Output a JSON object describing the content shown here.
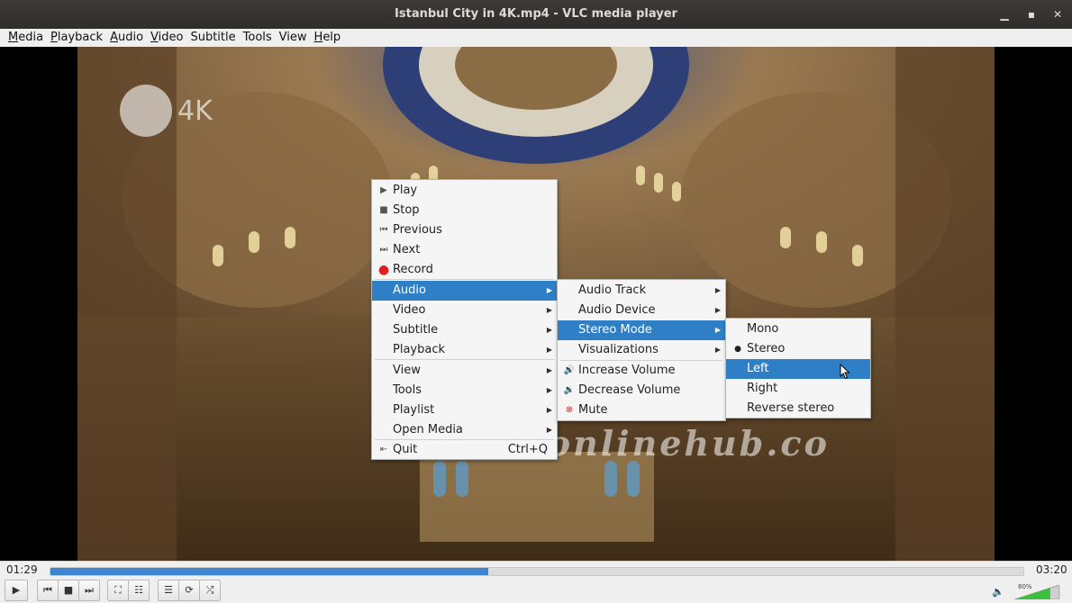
{
  "window": {
    "title": "Istanbul City in 4K.mp4 - VLC media player"
  },
  "menubar": {
    "items": [
      {
        "underline": "M",
        "rest": "edia"
      },
      {
        "underline": "P",
        "rest": "layback"
      },
      {
        "underline": "A",
        "rest": "udio"
      },
      {
        "underline": "V",
        "rest": "ideo"
      },
      {
        "underline": "",
        "rest": "Subtitle"
      },
      {
        "underline": "",
        "rest": "Tools"
      },
      {
        "underline": "",
        "rest": "View"
      },
      {
        "underline": "H",
        "rest": "elp"
      }
    ]
  },
  "video": {
    "logo_text": "4K",
    "watermark": "mulhamonlinehub.co"
  },
  "context_menu": {
    "items": [
      {
        "label": "Play",
        "icon": "play-icon"
      },
      {
        "label": "Stop",
        "icon": "stop-icon"
      },
      {
        "label": "Previous",
        "icon": "previous-icon"
      },
      {
        "label": "Next",
        "icon": "next-icon"
      },
      {
        "label": "Record",
        "icon": "record-icon"
      },
      {
        "label": "Audio",
        "submenu": true,
        "selected": true
      },
      {
        "label": "Video",
        "submenu": true
      },
      {
        "label": "Subtitle",
        "submenu": true
      },
      {
        "label": "Playback",
        "submenu": true
      },
      {
        "label": "View",
        "submenu": true
      },
      {
        "label": "Tools",
        "submenu": true
      },
      {
        "label": "Playlist",
        "submenu": true
      },
      {
        "label": "Open Media",
        "submenu": true
      },
      {
        "label": "Quit",
        "icon": "quit-icon",
        "shortcut": "Ctrl+Q"
      }
    ]
  },
  "audio_submenu": {
    "items": [
      {
        "label": "Audio Track",
        "submenu": true
      },
      {
        "label": "Audio Device",
        "submenu": true
      },
      {
        "label": "Stereo Mode",
        "submenu": true,
        "selected": true
      },
      {
        "label": "Visualizations",
        "submenu": true
      },
      {
        "label": "Increase Volume",
        "icon": "volume-up-icon"
      },
      {
        "label": "Decrease Volume",
        "icon": "volume-down-icon"
      },
      {
        "label": "Mute",
        "icon": "mute-icon"
      }
    ]
  },
  "stereo_submenu": {
    "items": [
      {
        "label": "Mono"
      },
      {
        "label": "Stereo",
        "checked": true
      },
      {
        "label": "Left",
        "selected": true
      },
      {
        "label": "Right"
      },
      {
        "label": "Reverse stereo"
      }
    ]
  },
  "controls": {
    "elapsed": "01:29",
    "total": "03:20",
    "progress": 0.45,
    "volume_label": "80%",
    "volume": 0.8
  },
  "colors": {
    "accent": "#2f7fc6",
    "record": "#e02020"
  }
}
